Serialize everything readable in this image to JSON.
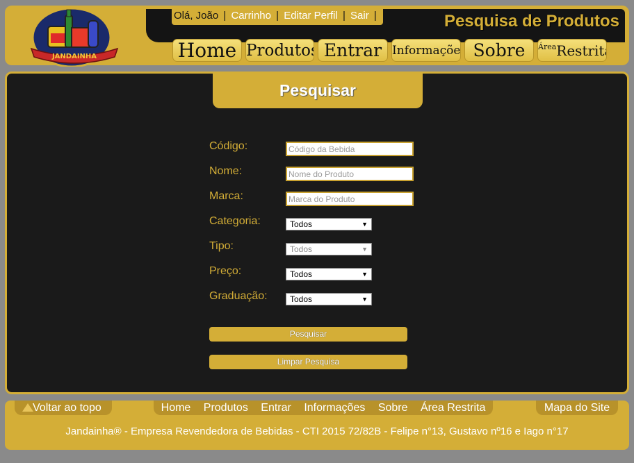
{
  "header": {
    "logo_text": "JANDAINHA",
    "user": {
      "greeting": "Olá, João",
      "links": [
        "Carrinho",
        "Editar Perfil",
        "Sair"
      ]
    },
    "page_title": "Pesquisa de Produtos",
    "nav": [
      "Home",
      "Produtos",
      "Entrar",
      "Informações",
      "Sobre",
      "Restrita"
    ],
    "nav_area_super": "Área"
  },
  "search": {
    "title": "Pesquisar",
    "fields": {
      "codigo": {
        "label": "Código:",
        "placeholder": "Código da Bebida"
      },
      "nome": {
        "label": "Nome:",
        "placeholder": "Nome do Produto"
      },
      "marca": {
        "label": "Marca:",
        "placeholder": "Marca do Produto"
      },
      "categoria": {
        "label": "Categoria:",
        "value": "Todos"
      },
      "tipo": {
        "label": "Tipo:",
        "value": "Todos"
      },
      "preco": {
        "label": "Preço:",
        "value": "Todos"
      },
      "graduacao": {
        "label": "Graduação:",
        "value": "Todos"
      }
    },
    "submit_label": "Pesquisar",
    "clear_label": "Limpar Pesquisa"
  },
  "footer": {
    "back_to_top": "Voltar ao topo",
    "nav": [
      "Home",
      "Produtos",
      "Entrar",
      "Informações",
      "Sobre",
      "Área Restrita"
    ],
    "sitemap": "Mapa do Site",
    "credits": "Jandainha® - Empresa Revendedora de Bebidas - CTI 2015 72/82B - Felipe n°13, Gustavo nº16 e Iago n°17"
  },
  "colors": {
    "accent": "#d4ae37",
    "background": "#1a1a1a"
  }
}
